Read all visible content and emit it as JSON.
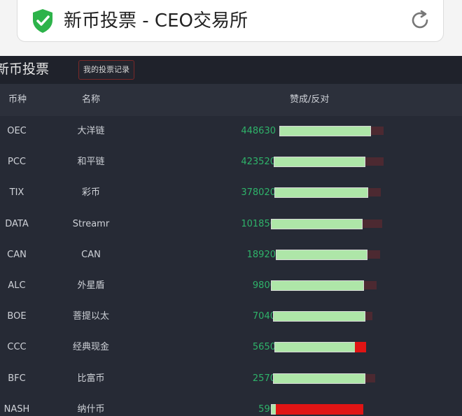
{
  "browser": {
    "page_title": "新币投票 - CEO交易所",
    "secure_icon": "shield-check-icon",
    "reload_icon": "reload-icon"
  },
  "app": {
    "title": "新币投票",
    "my_votes_label": "我的投票记录"
  },
  "table": {
    "headers": {
      "symbol": "币种",
      "name": "名称",
      "votes": "赞成/反对"
    },
    "colors": {
      "approve": "#aee6a8",
      "against": "#e01414",
      "number": "#2fb36a"
    },
    "rows": [
      {
        "symbol": "OEC",
        "name": "大洋链",
        "votes": "448630",
        "against_fraction": 0.0
      },
      {
        "symbol": "PCC",
        "name": "和平链",
        "votes": "423520",
        "against_fraction": 0.0
      },
      {
        "symbol": "TIX",
        "name": "彩币",
        "votes": "378020",
        "against_fraction": 0.0
      },
      {
        "symbol": "DATA",
        "name": "Streamr",
        "votes": "101850",
        "against_fraction": 0.0
      },
      {
        "symbol": "CAN",
        "name": "CAN",
        "votes": "18920",
        "against_fraction": 0.0
      },
      {
        "symbol": "ALC",
        "name": "外星盾",
        "votes": "9800",
        "against_fraction": 0.0
      },
      {
        "symbol": "BOE",
        "name": "菩提以太",
        "votes": "7040",
        "against_fraction": 0.0
      },
      {
        "symbol": "CCC",
        "name": "经典现金",
        "votes": "5650",
        "against_fraction": 0.12
      },
      {
        "symbol": "BFC",
        "name": "比富币",
        "votes": "2570",
        "against_fraction": 0.0
      },
      {
        "symbol": "NASH",
        "name": "纳什币",
        "votes": "590",
        "against_fraction": 0.95
      }
    ]
  }
}
